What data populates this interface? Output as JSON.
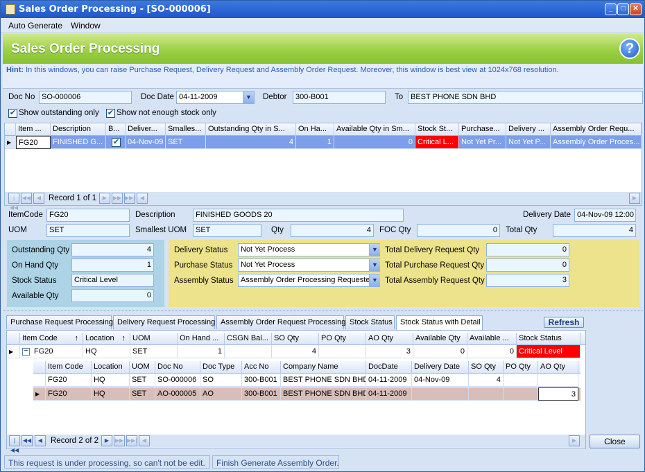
{
  "window": {
    "title": "Sales Order Processing - [SO-000006]"
  },
  "menu": {
    "auto_generate": "Auto Generate",
    "window": "Window"
  },
  "banner": {
    "title": "Sales Order Processing"
  },
  "hint": {
    "label": "Hint:",
    "text": "In this windows, you can raise Purchase Request, Delivery Request and Assembly Order Request. Moreover, this window is best view at 1024x768 resolution."
  },
  "header": {
    "doc_no_label": "Doc No",
    "doc_no": "SO-000006",
    "doc_date_label": "Doc Date",
    "doc_date": "04-11-2009",
    "debtor_label": "Debtor",
    "debtor": "300-B001",
    "to_label": "To",
    "to": "BEST PHONE SDN BHD",
    "show_outstanding": "Show outstanding only",
    "show_not_enough": "Show not enough stock only"
  },
  "top_grid": {
    "columns": [
      "Item ...",
      "Description",
      "B...",
      "Deliver...",
      "Smalles...",
      "Outstanding Qty in S...",
      "On Ha...",
      "Available Qty in Sm...",
      "Stock St...",
      "Purchase...",
      "Delivery ...",
      "Assembly Order Requ..."
    ],
    "row": [
      "FG20",
      "FINISHED G...",
      "",
      "04-Nov-09",
      "SET",
      "4",
      "1",
      "0",
      "Critical L...",
      "Not Yet Pr...",
      "Not Yet P...",
      "Assembly Order Proces..."
    ],
    "record": "Record 1 of 1"
  },
  "detail": {
    "itemcode_label": "ItemCode",
    "itemcode": "FG20",
    "description_label": "Description",
    "description": "FINISHED GOODS 20",
    "delivery_date_label": "Delivery Date",
    "delivery_date": "04-Nov-09 12:00",
    "uom_label": "UOM",
    "uom": "SET",
    "smallest_uom_label": "Smallest UOM",
    "smallest_uom": "SET",
    "qty_label": "Qty",
    "qty": "4",
    "foc_qty_label": "FOC Qty",
    "foc_qty": "0",
    "total_qty_label": "Total Qty",
    "total_qty": "4"
  },
  "stock": {
    "outstanding_label": "Outstanding Qty",
    "outstanding": "4",
    "onhand_label": "On Hand Qty",
    "onhand": "1",
    "status_label": "Stock Status",
    "status": "Critical Level",
    "available_label": "Available Qty",
    "available": "0"
  },
  "process": {
    "delivery_label": "Delivery Status",
    "delivery": "Not Yet Process",
    "purchase_label": "Purchase Status",
    "purchase": "Not Yet Process",
    "assembly_label": "Assembly Status",
    "assembly": "Assembly Order Processing Requested",
    "total_delivery_label": "Total Delivery Request Qty",
    "total_delivery": "0",
    "total_purchase_label": "Total Purchase Request Qty",
    "total_purchase": "0",
    "total_assembly_label": "Total Assembly Request Qty",
    "total_assembly": "3"
  },
  "tabs": [
    "Purchase Request Processing",
    "Delivery Request Processing",
    "Assembly Order Request Processing",
    "Stock Status",
    "Stock Status with Detail"
  ],
  "refresh": "Refresh",
  "bottom_grid": {
    "columns": [
      "Item Code",
      "Location",
      "UOM",
      "On Hand ...",
      "CSGN Bal...",
      "SO Qty",
      "PO Qty",
      "AO Qty",
      "Available Qty",
      "Available ...",
      "Stock Status"
    ],
    "row": [
      "FG20",
      "HQ",
      "SET",
      "1",
      "",
      "4",
      "",
      "3",
      "0",
      "0",
      "Critical Level"
    ],
    "sub_columns": [
      "Item Code",
      "Location",
      "UOM",
      "Doc No",
      "Doc Type",
      "Acc No",
      "Company Name",
      "DocDate",
      "Delivery Date",
      "SO Qty",
      "PO Qty",
      "AO Qty"
    ],
    "sub_rows": [
      [
        "FG20",
        "HQ",
        "SET",
        "SO-000006",
        "SO",
        "300-B001",
        "BEST PHONE SDN BHD",
        "04-11-2009",
        "04-Nov-09",
        "4",
        "",
        ""
      ],
      [
        "FG20",
        "HQ",
        "SET",
        "AO-000005",
        "AO",
        "300-B001",
        "BEST PHONE SDN BHD",
        "04-11-2009",
        "",
        "",
        "",
        "3"
      ]
    ],
    "record": "Record 2 of 2"
  },
  "close": "Close",
  "statusbar": {
    "left": "This request is under processing, so can't not be edit.",
    "right": "Finish Generate Assembly Order."
  }
}
